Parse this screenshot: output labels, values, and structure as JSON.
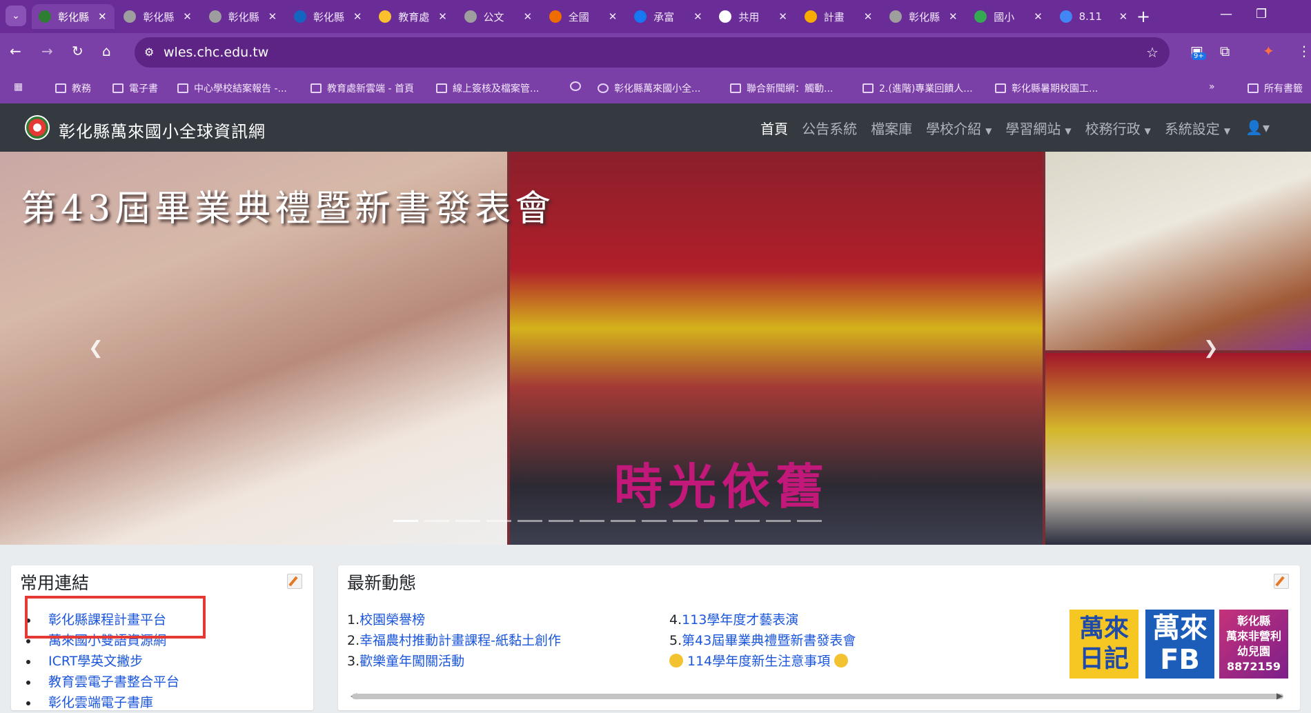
{
  "browser": {
    "tabs": [
      {
        "label": "彰化縣",
        "active": true,
        "favicon_color": "#2e7d32"
      },
      {
        "label": "彰化縣",
        "active": false,
        "favicon_color": "#9e9e9e"
      },
      {
        "label": "彰化縣",
        "active": false,
        "favicon_color": "#9e9e9e"
      },
      {
        "label": "彰化縣",
        "active": false,
        "favicon_color": "#1565c0"
      },
      {
        "label": "教育處",
        "active": false,
        "favicon_color": "#fbc02d"
      },
      {
        "label": "公文",
        "active": false,
        "favicon_color": "#9e9e9e"
      },
      {
        "label": "全國",
        "active": false,
        "favicon_color": "#ef6c00"
      },
      {
        "label": "承富",
        "active": false,
        "favicon_color": "#1877f2"
      },
      {
        "label": "共用",
        "active": false,
        "favicon_color": "#ffffff"
      },
      {
        "label": "計畫",
        "active": false,
        "favicon_color": "#f9ab00"
      },
      {
        "label": "彰化縣",
        "active": false,
        "favicon_color": "#9e9e9e"
      },
      {
        "label": "國小",
        "active": false,
        "favicon_color": "#34a853"
      },
      {
        "label": "8.11",
        "active": false,
        "favicon_color": "#4285f4"
      }
    ],
    "url": "wles.chc.edu.tw",
    "extension_badge": "9+",
    "bookmarks": [
      {
        "label": "教務",
        "icon": "folder-icon"
      },
      {
        "label": "電子書",
        "icon": "folder-icon"
      },
      {
        "label": "中心學校結案報告 -...",
        "icon": "drive-icon"
      },
      {
        "label": "教育處新雲端 - 首頁",
        "icon": "cloud-icon"
      },
      {
        "label": "線上簽核及檔案管...",
        "icon": "doc-icon"
      },
      {
        "label": "",
        "icon": "globe-icon"
      },
      {
        "label": "彰化縣萬來國小全...",
        "icon": "school-icon"
      },
      {
        "label": "聯合新聞網：觸動...",
        "icon": "news-icon"
      },
      {
        "label": "2.(進階)專業回饋人...",
        "icon": "drive-icon"
      },
      {
        "label": "彰化縣暑期校園工...",
        "icon": "doc-icon"
      }
    ],
    "bookmarks_overflow": "»",
    "all_bookmarks": "所有書籤"
  },
  "site": {
    "title": "彰化縣萬來國小全球資訊網",
    "menu": [
      {
        "label": "首頁",
        "active": true,
        "dropdown": false
      },
      {
        "label": "公告系統",
        "active": false,
        "dropdown": false
      },
      {
        "label": "檔案庫",
        "active": false,
        "dropdown": false
      },
      {
        "label": "學校介紹",
        "active": false,
        "dropdown": true
      },
      {
        "label": "學習網站",
        "active": false,
        "dropdown": true
      },
      {
        "label": "校務行政",
        "active": false,
        "dropdown": true
      },
      {
        "label": "系統設定",
        "active": false,
        "dropdown": true
      }
    ]
  },
  "carousel": {
    "caption": "第43屆畢業典禮暨新書發表會",
    "stage_text": "時光依舊",
    "slide_count": 14,
    "active_slide": 1
  },
  "links_card": {
    "title": "常用連結",
    "items": [
      "彰化縣課程計畫平台",
      "萬來國小雙語資源網",
      "ICRT學英文撇步",
      "教育雲電子書整合平台",
      "彰化雲端電子書庫"
    ]
  },
  "news_card": {
    "title": "最新動態",
    "col1": [
      {
        "num": "1.",
        "title": "校園榮譽榜"
      },
      {
        "num": "2.",
        "title": "幸福農村推動計畫課程-紙黏土創作"
      },
      {
        "num": "3.",
        "title": "歡樂童年闖關活動"
      }
    ],
    "col2": [
      {
        "num": "4.",
        "title": "113學年度才藝表演"
      },
      {
        "num": "5.",
        "title": "第43屆畢業典禮暨新書發表會"
      },
      {
        "num": "",
        "title": "114學年度新生注意事項"
      }
    ],
    "tiles": [
      {
        "text": "萬來\n日記"
      },
      {
        "text": "萬來\nFB"
      },
      {
        "text": "彰化縣\n萬來非營利\n幼兒園\n8872159"
      }
    ]
  }
}
